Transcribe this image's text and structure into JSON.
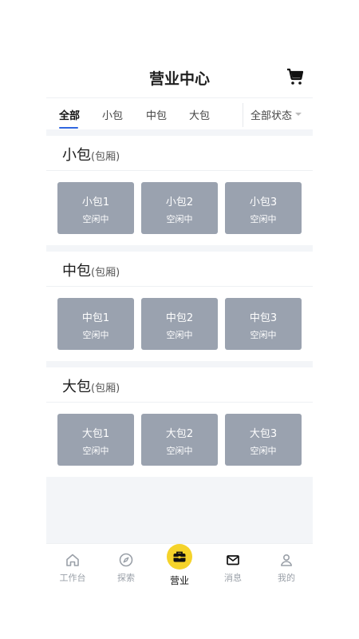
{
  "header": {
    "title": "营业中心",
    "cart_icon": "cart-icon"
  },
  "tabs": [
    {
      "label": "全部",
      "active": true
    },
    {
      "label": "小包",
      "active": false
    },
    {
      "label": "中包",
      "active": false
    },
    {
      "label": "大包",
      "active": false
    }
  ],
  "status_filter": {
    "label": "全部状态"
  },
  "sections": [
    {
      "title": "小包",
      "subtitle": "(包厢)",
      "rooms": [
        {
          "name": "小包1",
          "status": "空闲中"
        },
        {
          "name": "小包2",
          "status": "空闲中"
        },
        {
          "name": "小包3",
          "status": "空闲中"
        }
      ]
    },
    {
      "title": "中包",
      "subtitle": "(包厢)",
      "rooms": [
        {
          "name": "中包1",
          "status": "空闲中"
        },
        {
          "name": "中包2",
          "status": "空闲中"
        },
        {
          "name": "中包3",
          "status": "空闲中"
        }
      ]
    },
    {
      "title": "大包",
      "subtitle": "(包厢)",
      "rooms": [
        {
          "name": "大包1",
          "status": "空闲中"
        },
        {
          "name": "大包2",
          "status": "空闲中"
        },
        {
          "name": "大包3",
          "status": "空闲中"
        }
      ]
    }
  ],
  "tabbar": [
    {
      "label": "工作台",
      "icon": "home-icon",
      "active": false
    },
    {
      "label": "探索",
      "icon": "compass-icon",
      "active": false
    },
    {
      "label": "营业",
      "icon": "briefcase-icon",
      "active": true
    },
    {
      "label": "消息",
      "icon": "mail-icon",
      "active": false
    },
    {
      "label": "我的",
      "icon": "user-icon",
      "active": false
    }
  ],
  "colors": {
    "accent": "#2f66e0",
    "room_idle": "#9aa2af",
    "active_tab_bg": "#f5d32a"
  }
}
